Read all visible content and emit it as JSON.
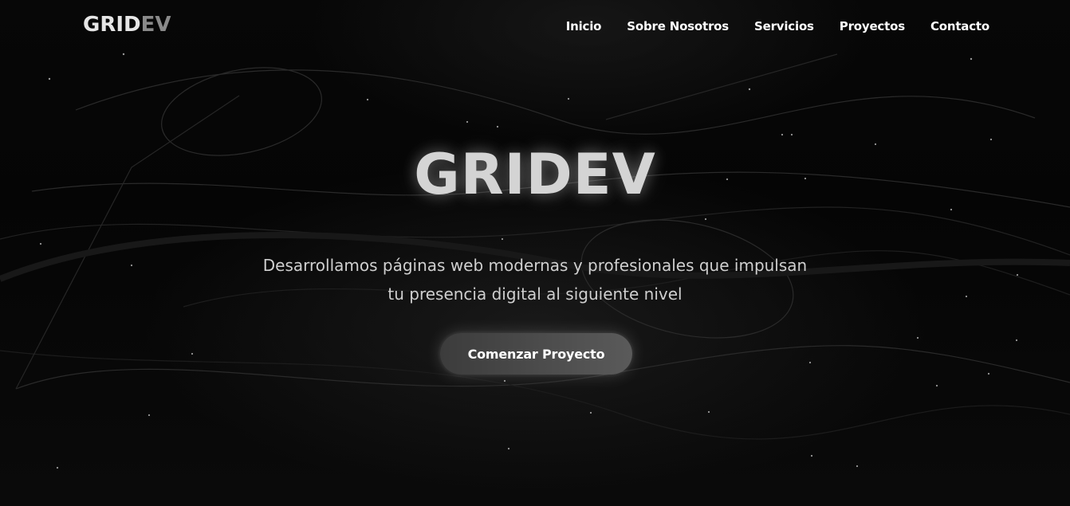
{
  "brand": {
    "logo_main": "GRID",
    "logo_accent": "EV"
  },
  "nav": {
    "items": [
      "Inicio",
      "Sobre Nosotros",
      "Servicios",
      "Proyectos",
      "Contacto"
    ]
  },
  "hero": {
    "title": "GRIDEV",
    "subtitle": "Desarrollamos páginas web modernas y profesionales que impulsan tu presencia digital al siguiente nivel",
    "cta_label": "Comenzar Proyecto"
  },
  "colors": {
    "background": "#000000",
    "title": "#d4d4d4",
    "accent": "#8a8a8a",
    "button": "#4a4a4a"
  }
}
